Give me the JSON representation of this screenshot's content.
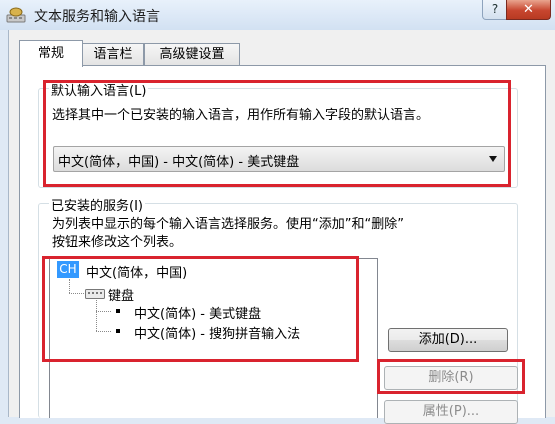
{
  "window": {
    "title": "文本服务和输入语言",
    "help_glyph": "?",
    "close_glyph": "✕"
  },
  "tabs": [
    {
      "label": "常规",
      "active": true
    },
    {
      "label": "语言栏",
      "active": false
    },
    {
      "label": "高级键设置",
      "active": false
    }
  ],
  "default_language": {
    "group_label": "默认输入语言(L)",
    "description": "选择其中一个已安装的输入语言，用作所有输入字段的默认语言。",
    "selected": "中文(简体，中国) - 中文(简体) - 美式键盘"
  },
  "installed_services": {
    "group_label": "已安装的服务(I)",
    "description_line1": "为列表中显示的每个输入语言选择服务。使用“添加”和“删除”",
    "description_line2": "按钮来修改这个列表。",
    "tree": {
      "language_code": "CH",
      "language": "中文(简体，中国)",
      "category": "键盘",
      "items": [
        "中文(简体) - 美式键盘",
        "中文(简体) - 搜狗拼音输入法"
      ]
    },
    "buttons": {
      "add": "添加(D)...",
      "remove": "删除(R)",
      "properties": "属性(P)..."
    }
  },
  "colors": {
    "highlight_red": "#d9232e",
    "selection_blue": "#3399ff",
    "close_red": "#c7462f"
  }
}
